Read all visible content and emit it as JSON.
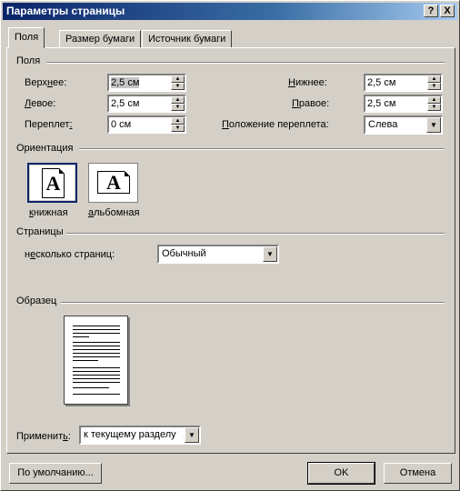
{
  "window": {
    "title": "Параметры страницы",
    "help_label": "?",
    "close_label": "X"
  },
  "tabs": [
    {
      "label": "Поля",
      "active": true
    },
    {
      "label": "Размер бумаги",
      "active": false
    },
    {
      "label": "Источник бумаги",
      "active": false
    }
  ],
  "margins": {
    "group_label": "Поля",
    "top": {
      "label_pre": "Верх",
      "label_ul": "н",
      "label_post": "ее:",
      "value": "2,5 см"
    },
    "bottom": {
      "label_pre": "",
      "label_ul": "Н",
      "label_post": "ижнее:",
      "value": "2,5 см"
    },
    "left": {
      "label_pre": "",
      "label_ul": "Л",
      "label_post": "евое:",
      "value": "2,5 см"
    },
    "right": {
      "label_pre": "",
      "label_ul": "П",
      "label_post": "равое:",
      "value": "2,5 см"
    },
    "gutter": {
      "label_pre": "Переплет",
      "label_ul": ":",
      "label_post": "",
      "value": "0 см"
    },
    "gutter_pos": {
      "label_pre": "",
      "label_ul": "П",
      "label_post": "оложение переплета:",
      "value": "Слева"
    }
  },
  "orientation": {
    "group_label": "Ориентация",
    "portrait": {
      "label_pre": "",
      "label_ul": "к",
      "label_post": "нижная",
      "glyph": "A"
    },
    "landscape": {
      "label_pre": "",
      "label_ul": "а",
      "label_post": "льбомная",
      "glyph": "A"
    }
  },
  "pages": {
    "group_label": "Страницы",
    "multiple_label_pre": "н",
    "multiple_label_ul": "е",
    "multiple_label_post": "сколько страниц:",
    "multiple_value": "Обычный"
  },
  "preview": {
    "group_label": "Образец"
  },
  "apply": {
    "label_pre": "Применит",
    "label_ul": "ь",
    "label_post": ":",
    "value": "к текущему разделу"
  },
  "buttons": {
    "default": "По умолчанию...",
    "ok": "OK",
    "cancel": "Отмена"
  }
}
